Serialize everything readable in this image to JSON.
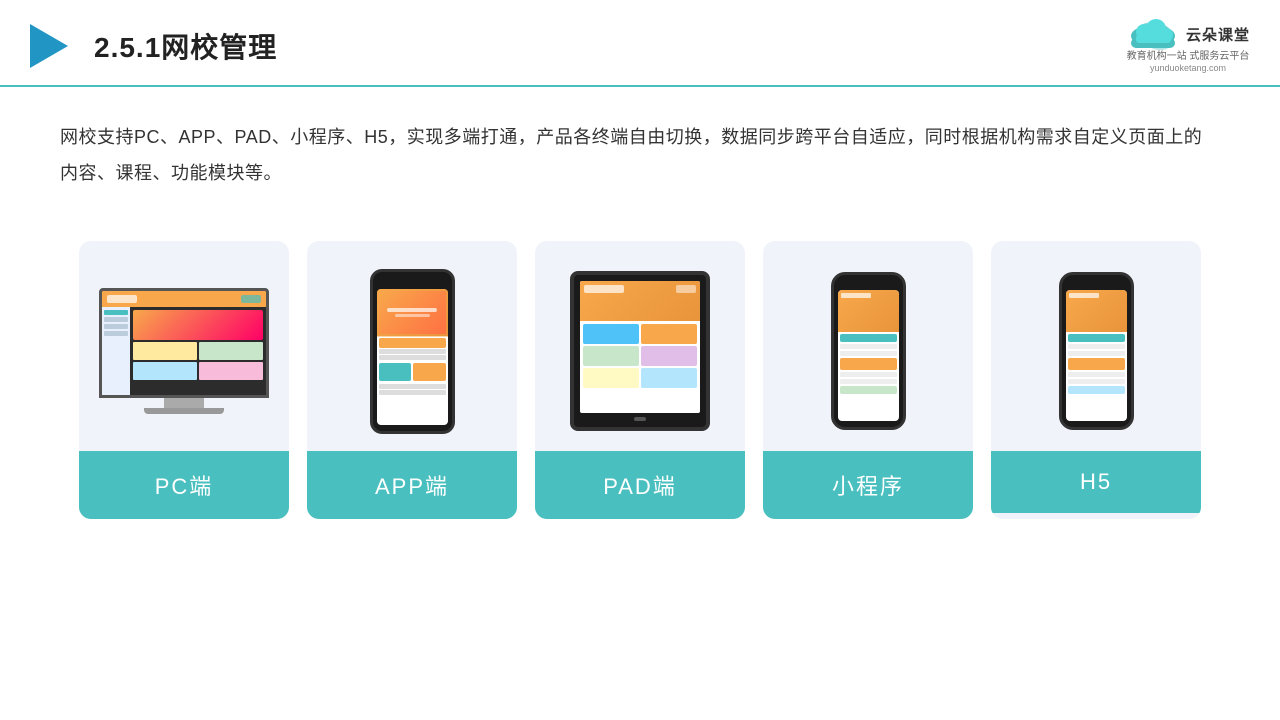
{
  "header": {
    "title": "2.5.1网校管理",
    "logo_name": "云朵课堂",
    "logo_tagline": "教育机构一站\n式服务云平台",
    "logo_url": "yunduoketang.com"
  },
  "description": {
    "text": "网校支持PC、APP、PAD、小程序、H5，实现多端打通，产品各终端自由切换，数据同步跨平台自适应，同时根据机构需求自定义页面上的内容、课程、功能模块等。"
  },
  "cards": [
    {
      "id": "pc",
      "label": "PC端",
      "type": "pc"
    },
    {
      "id": "app",
      "label": "APP端",
      "type": "phone"
    },
    {
      "id": "pad",
      "label": "PAD端",
      "type": "tablet"
    },
    {
      "id": "miniprogram",
      "label": "小程序",
      "type": "phone-mini"
    },
    {
      "id": "h5",
      "label": "H5",
      "type": "phone-mini2"
    }
  ],
  "colors": {
    "accent": "#4ABFBF",
    "header_border": "#4ABFBF",
    "card_bg": "#f0f4fa",
    "label_bg": "#4ABFBF",
    "label_text": "#ffffff"
  }
}
